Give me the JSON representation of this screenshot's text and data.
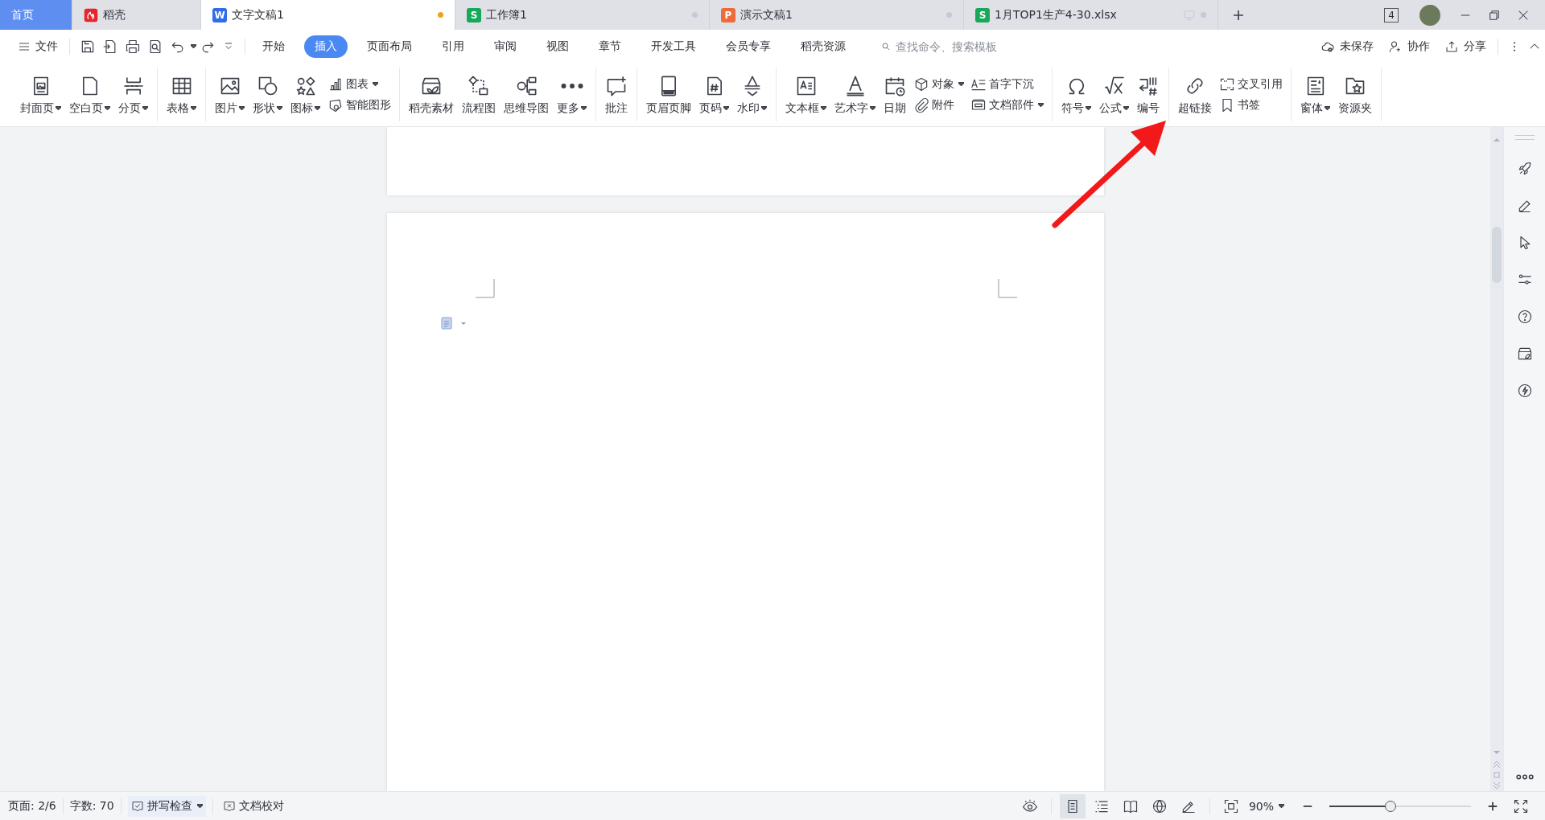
{
  "tabs": [
    {
      "label": "首页",
      "kind": "home",
      "selected": false
    },
    {
      "label": "稻壳",
      "kind": "docer",
      "selected": false
    },
    {
      "label": "文字文稿1",
      "kind": "writer",
      "badge": "W",
      "selected": true,
      "unsaved": true,
      "casting": false
    },
    {
      "label": "工作簿1",
      "kind": "sheet",
      "badge": "S",
      "selected": false,
      "unsaved": false,
      "casting": false
    },
    {
      "label": "演示文稿1",
      "kind": "slides",
      "badge": "P",
      "selected": false,
      "unsaved": false,
      "casting": false
    },
    {
      "label": "1月TOP1生产4-30.xlsx",
      "kind": "sheet",
      "badge": "S",
      "selected": false,
      "unsaved": false,
      "casting": true
    }
  ],
  "window_controls": {
    "window_count": "4"
  },
  "menu": {
    "file": "文件",
    "tabs": [
      {
        "label": "开始",
        "selected": false
      },
      {
        "label": "插入",
        "selected": true
      },
      {
        "label": "页面布局",
        "selected": false
      },
      {
        "label": "引用",
        "selected": false
      },
      {
        "label": "审阅",
        "selected": false
      },
      {
        "label": "视图",
        "selected": false
      },
      {
        "label": "章节",
        "selected": false
      },
      {
        "label": "开发工具",
        "selected": false
      },
      {
        "label": "会员专享",
        "selected": false
      },
      {
        "label": "稻壳资源",
        "selected": false
      }
    ],
    "search": {
      "placeholder": "查找命令、搜索模板"
    },
    "actions": [
      "未保存",
      "协作",
      "分享"
    ]
  },
  "ribbon": {
    "groups": [
      {
        "items": [
          {
            "kind": "big",
            "label": "封面页",
            "dropdown": true
          },
          {
            "kind": "big",
            "label": "空白页",
            "dropdown": true
          },
          {
            "kind": "big",
            "label": "分页",
            "dropdown": true
          }
        ]
      },
      {
        "items": [
          {
            "kind": "big",
            "label": "表格",
            "dropdown": true
          }
        ]
      },
      {
        "items": [
          {
            "kind": "big",
            "label": "图片",
            "dropdown": true
          },
          {
            "kind": "big",
            "label": "形状",
            "dropdown": true
          },
          {
            "kind": "big",
            "label": "图标",
            "dropdown": true
          },
          {
            "kind": "stack",
            "items": [
              {
                "label": "图表",
                "dropdown": true
              },
              {
                "label": "智能图形",
                "dropdown": false
              }
            ]
          }
        ]
      },
      {
        "items": [
          {
            "kind": "big",
            "label": "稻壳素材",
            "dropdown": false
          },
          {
            "kind": "big",
            "label": "流程图",
            "dropdown": false
          },
          {
            "kind": "big",
            "label": "思维导图",
            "dropdown": false
          },
          {
            "kind": "big",
            "label": "更多",
            "dropdown": true
          }
        ]
      },
      {
        "items": [
          {
            "kind": "big",
            "label": "批注",
            "dropdown": false
          }
        ]
      },
      {
        "items": [
          {
            "kind": "big",
            "label": "页眉页脚",
            "dropdown": false
          },
          {
            "kind": "big",
            "label": "页码",
            "dropdown": true
          },
          {
            "kind": "big",
            "label": "水印",
            "dropdown": true
          }
        ]
      },
      {
        "items": [
          {
            "kind": "big",
            "label": "文本框",
            "dropdown": true
          },
          {
            "kind": "big",
            "label": "艺术字",
            "dropdown": true
          },
          {
            "kind": "big",
            "label": "日期",
            "dropdown": false
          },
          {
            "kind": "stack",
            "items": [
              {
                "label": "对象",
                "dropdown": true
              },
              {
                "label": "附件",
                "dropdown": false
              }
            ]
          },
          {
            "kind": "stack",
            "items": [
              {
                "label": "首字下沉",
                "dropdown": false
              },
              {
                "label": "文档部件",
                "dropdown": true
              }
            ]
          }
        ]
      },
      {
        "items": [
          {
            "kind": "big",
            "label": "符号",
            "dropdown": true
          },
          {
            "kind": "big",
            "label": "公式",
            "dropdown": true
          },
          {
            "kind": "big",
            "label": "编号",
            "dropdown": false
          }
        ]
      },
      {
        "items": [
          {
            "kind": "big",
            "label": "超链接",
            "dropdown": false
          },
          {
            "kind": "stack",
            "items": [
              {
                "label": "交叉引用",
                "dropdown": false
              },
              {
                "label": "书签",
                "dropdown": false
              }
            ]
          }
        ]
      },
      {
        "items": [
          {
            "kind": "big",
            "label": "窗体",
            "dropdown": true
          },
          {
            "kind": "big",
            "label": "资源夹",
            "dropdown": false
          }
        ]
      }
    ]
  },
  "status_bar": {
    "page": "页面: 2/6",
    "words": "字数: 70",
    "spell_check": "拼写检查",
    "proofread": "文档校对",
    "view_modes": [
      {
        "selected": true
      },
      {
        "selected": false
      },
      {
        "selected": false
      },
      {
        "selected": false
      },
      {
        "selected": false
      }
    ],
    "zoom": "90%",
    "zoom_slider": {
      "level": 0.43
    }
  }
}
